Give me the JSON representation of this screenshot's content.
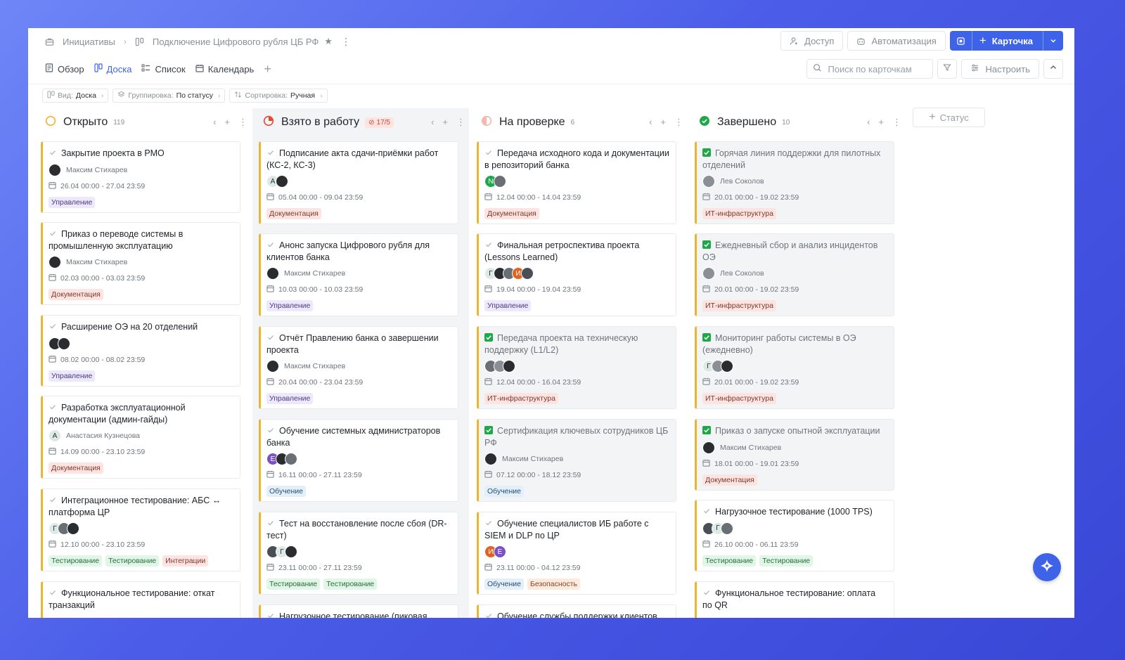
{
  "breadcrumb": {
    "root": "Инициативы",
    "project": "Подключение Цифрового рубля ЦБ РФ"
  },
  "top_actions": {
    "access": "Доступ",
    "automation": "Автоматизация",
    "card": "Карточка"
  },
  "tabs": [
    {
      "label": "Обзор"
    },
    {
      "label": "Доска"
    },
    {
      "label": "Список"
    },
    {
      "label": "Календарь"
    }
  ],
  "search": {
    "placeholder": "Поиск по карточкам"
  },
  "configure": "Настроить",
  "filters": [
    {
      "label": "Вид:",
      "value": "Доска"
    },
    {
      "label": "Группировка:",
      "value": "По статусу"
    },
    {
      "label": "Сортировка:",
      "value": "Ручная"
    }
  ],
  "add_status": "Статус",
  "colors": {
    "accent": "#3f63e8",
    "card_border": "#f0b429",
    "done": "#1fa84a",
    "wip": "#d7452f"
  },
  "columns": [
    {
      "title": "Открыто",
      "count": "119",
      "cards": [
        {
          "title": "Закрытие проекта в РМО",
          "person": "Максим Стихарев",
          "date": "26.04 00:00 - 27.04 23:59",
          "tags": [
            {
              "t": "Управление",
              "c": "purple"
            }
          ]
        },
        {
          "title": "Приказ о переводе системы в промышленную эксплуатацию",
          "person": "Максим Стихарев",
          "date": "02.03 00:00 - 03.03 23:59",
          "tags": [
            {
              "t": "Документация",
              "c": "red"
            }
          ]
        },
        {
          "title": "Расширение ОЭ на 20 отделений",
          "date": "08.02 00:00 - 08.02 23:59",
          "tags": [
            {
              "t": "Управление",
              "c": "purple"
            }
          ]
        },
        {
          "title": "Разработка эксплуатационной документации (админ-гайды)",
          "person": "Анастасия Кузнецова",
          "date": "14.09 00:00 - 23.10 23:59",
          "tags": [
            {
              "t": "Документация",
              "c": "red"
            }
          ]
        },
        {
          "title": "Интеграционное тестирование: АБС ↔ платформа ЦР",
          "date": "12.10 00:00 - 23.10 23:59",
          "tags": [
            {
              "t": "Тестирование",
              "c": "green"
            },
            {
              "t": "Тестирование",
              "c": "green"
            },
            {
              "t": "Интеграции",
              "c": "red"
            }
          ]
        },
        {
          "title": "Функциональное тестирование: откат транзакций"
        }
      ]
    },
    {
      "title": "Взято в работу",
      "wip": "17/5",
      "cards": [
        {
          "title": "Подписание акта сдачи-приёмки работ (КС-2, КС-3)",
          "date": "05.04 00:00 - 09.04 23:59",
          "tags": [
            {
              "t": "Документация",
              "c": "red"
            }
          ]
        },
        {
          "title": "Анонс запуска Цифрового рубля для клиентов банка",
          "person": "Максим Стихарев",
          "date": "10.03 00:00 - 10.03 23:59",
          "tags": [
            {
              "t": "Управление",
              "c": "purple"
            }
          ]
        },
        {
          "title": "Отчёт Правлению банка о завершении проекта",
          "person": "Максим Стихарев",
          "date": "20.04 00:00 - 23.04 23:59",
          "tags": [
            {
              "t": "Управление",
              "c": "purple"
            }
          ]
        },
        {
          "title": "Обучение системных администраторов банка",
          "date": "16.11 00:00 - 27.11 23:59",
          "tags": [
            {
              "t": "Обучение",
              "c": "blue"
            }
          ]
        },
        {
          "title": "Тест на восстановление после сбоя (DR-тест)",
          "date": "23.11 00:00 - 27.11 23:59",
          "tags": [
            {
              "t": "Тестирование",
              "c": "green"
            },
            {
              "t": "Тестирование",
              "c": "green"
            }
          ]
        },
        {
          "title": "Нагрузочное тестирование (пиковая"
        }
      ]
    },
    {
      "title": "На проверке",
      "count": "6",
      "cards": [
        {
          "title": "Передача исходного кода и документации в репозиторий банка",
          "date": "12.04 00:00 - 14.04 23:59",
          "tags": [
            {
              "t": "Документация",
              "c": "red"
            }
          ]
        },
        {
          "title": "Финальная ретроспектива проекта (Lessons Learned)",
          "date": "19.04 00:00 - 19.04 23:59",
          "tags": [
            {
              "t": "Управление",
              "c": "purple"
            }
          ]
        },
        {
          "title": "Передача проекта на техническую поддержку (L1/L2)",
          "date": "12.04 00:00 - 16.04 23:59",
          "tags": [
            {
              "t": "ИТ-инфраструктура",
              "c": "red"
            }
          ]
        },
        {
          "title": "Сертификация ключевых сотрудников ЦБ РФ",
          "person": "Максим Стихарев",
          "date": "07.12 00:00 - 18.12 23:59",
          "tags": [
            {
              "t": "Обучение",
              "c": "blue"
            }
          ]
        },
        {
          "title": "Обучение специалистов ИБ работе с SIEM и DLP по ЦР",
          "date": "23.11 00:00 - 04.12 23:59",
          "tags": [
            {
              "t": "Обучение",
              "c": "blue"
            },
            {
              "t": "Безопасность",
              "c": "orange"
            }
          ]
        },
        {
          "title": "Обучение службы поддержки клиентов"
        }
      ]
    },
    {
      "title": "Завершено",
      "count": "10",
      "cards": [
        {
          "title": "Горячая линия поддержки для пилотных отделений",
          "person": "Лев Соколов",
          "date": "20.01 00:00 - 19.02 23:59",
          "tags": [
            {
              "t": "ИТ-инфраструктура",
              "c": "red"
            }
          ]
        },
        {
          "title": "Ежедневный сбор и анализ инцидентов ОЭ",
          "person": "Лев Соколов",
          "date": "20.01 00:00 - 19.02 23:59",
          "tags": [
            {
              "t": "ИТ-инфраструктура",
              "c": "red"
            }
          ]
        },
        {
          "title": "Мониторинг работы системы в ОЭ (ежедневно)",
          "date": "20.01 00:00 - 19.02 23:59",
          "tags": [
            {
              "t": "ИТ-инфраструктура",
              "c": "red"
            }
          ]
        },
        {
          "title": "Приказ о запуске опытной эксплуатации",
          "person": "Максим Стихарев",
          "date": "18.01 00:00 - 19.01 23:59",
          "tags": [
            {
              "t": "Документация",
              "c": "red"
            }
          ]
        },
        {
          "title": "Нагрузочное тестирование (1000 TPS)",
          "date": "26.10 00:00 - 06.11 23:59",
          "tags": [
            {
              "t": "Тестирование",
              "c": "green"
            },
            {
              "t": "Тестирование",
              "c": "green"
            }
          ]
        },
        {
          "title": "Функциональное тестирование: оплата по QR"
        }
      ]
    }
  ],
  "avatar_letters": {
    "a": "А",
    "g": "Г",
    "n": "N",
    "i": "И",
    "e": "Е"
  }
}
